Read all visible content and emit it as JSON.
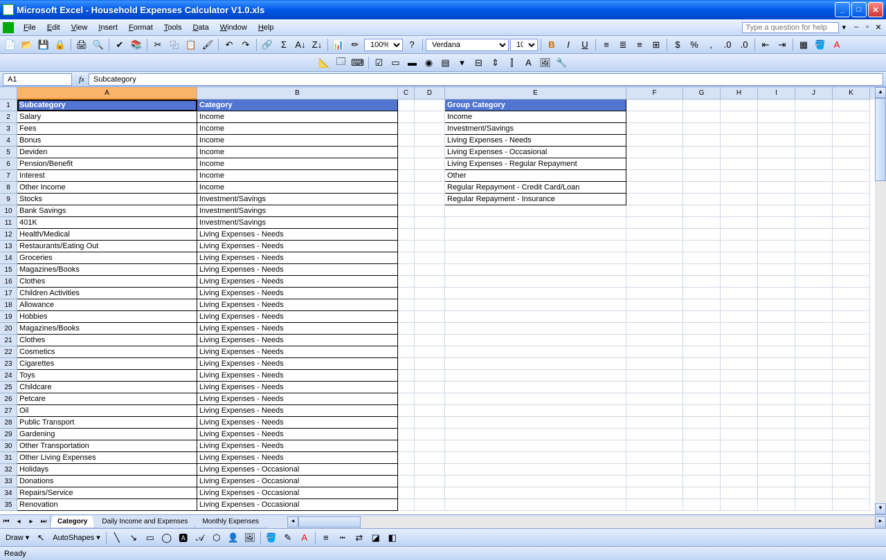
{
  "title": "Microsoft Excel - Household Expenses Calculator V1.0.xls",
  "menu": [
    "File",
    "Edit",
    "View",
    "Insert",
    "Format",
    "Tools",
    "Data",
    "Window",
    "Help"
  ],
  "help_placeholder": "Type a question for help",
  "namebox": "A1",
  "formula": "Subcategory",
  "font_name": "Verdana",
  "font_size": "10",
  "zoom": "100%",
  "columns": [
    "A",
    "B",
    "C",
    "D",
    "E",
    "F",
    "G",
    "H",
    "I",
    "J",
    "K"
  ],
  "col_classes": [
    "cA",
    "cB",
    "cC",
    "cD",
    "cE",
    "cF",
    "cG",
    "cH",
    "cI",
    "cJ",
    "cK"
  ],
  "active_col": "A",
  "header_a": "Subcategory",
  "header_b": "Category",
  "header_e": "Group Category",
  "tableAB": [
    [
      "Salary",
      "Income"
    ],
    [
      "Fees",
      "Income"
    ],
    [
      "Bonus",
      "Income"
    ],
    [
      "Deviden",
      "Income"
    ],
    [
      "Pension/Benefit",
      "Income"
    ],
    [
      "Interest",
      "Income"
    ],
    [
      "Other Income",
      "Income"
    ],
    [
      "Stocks",
      "Investment/Savings"
    ],
    [
      "Bank Savings",
      "Investment/Savings"
    ],
    [
      "401K",
      "Investment/Savings"
    ],
    [
      "Health/Medical",
      "Living Expenses - Needs"
    ],
    [
      "Restaurants/Eating Out",
      "Living Expenses - Needs"
    ],
    [
      "Groceries",
      "Living Expenses - Needs"
    ],
    [
      "Magazines/Books",
      "Living Expenses - Needs"
    ],
    [
      "Clothes",
      "Living Expenses - Needs"
    ],
    [
      "Children Activities",
      "Living Expenses - Needs"
    ],
    [
      "Allowance",
      "Living Expenses - Needs"
    ],
    [
      "Hobbies",
      "Living Expenses - Needs"
    ],
    [
      "Magazines/Books",
      "Living Expenses - Needs"
    ],
    [
      "Clothes",
      "Living Expenses - Needs"
    ],
    [
      "Cosmetics",
      "Living Expenses - Needs"
    ],
    [
      "Cigarettes",
      "Living Expenses - Needs"
    ],
    [
      "Toys",
      "Living Expenses - Needs"
    ],
    [
      "Childcare",
      "Living Expenses - Needs"
    ],
    [
      "Petcare",
      "Living Expenses - Needs"
    ],
    [
      "Oil",
      "Living Expenses - Needs"
    ],
    [
      "Public Transport",
      "Living Expenses - Needs"
    ],
    [
      "Gardening",
      "Living Expenses - Needs"
    ],
    [
      "Other Transportation",
      "Living Expenses - Needs"
    ],
    [
      "Other Living Expenses",
      "Living Expenses - Needs"
    ],
    [
      "Holidays",
      "Living Expenses - Occasional"
    ],
    [
      "Donations",
      "Living Expenses - Occasional"
    ],
    [
      "Repairs/Service",
      "Living Expenses - Occasional"
    ],
    [
      "Renovation",
      "Living Expenses - Occasional"
    ]
  ],
  "tableE": [
    "Income",
    "Investment/Savings",
    "Living Expenses - Needs",
    "Living Expenses - Occasional",
    "Living Expenses - Regular Repayment",
    "Other",
    "Regular Repayment - Credit Card/Loan",
    "Regular Repayment - Insurance"
  ],
  "sheet_tabs": [
    "Category",
    "Daily Income and Expenses",
    "Monthly Expenses"
  ],
  "active_tab": 0,
  "draw_label": "Draw",
  "autoshapes_label": "AutoShapes",
  "status": "Ready"
}
